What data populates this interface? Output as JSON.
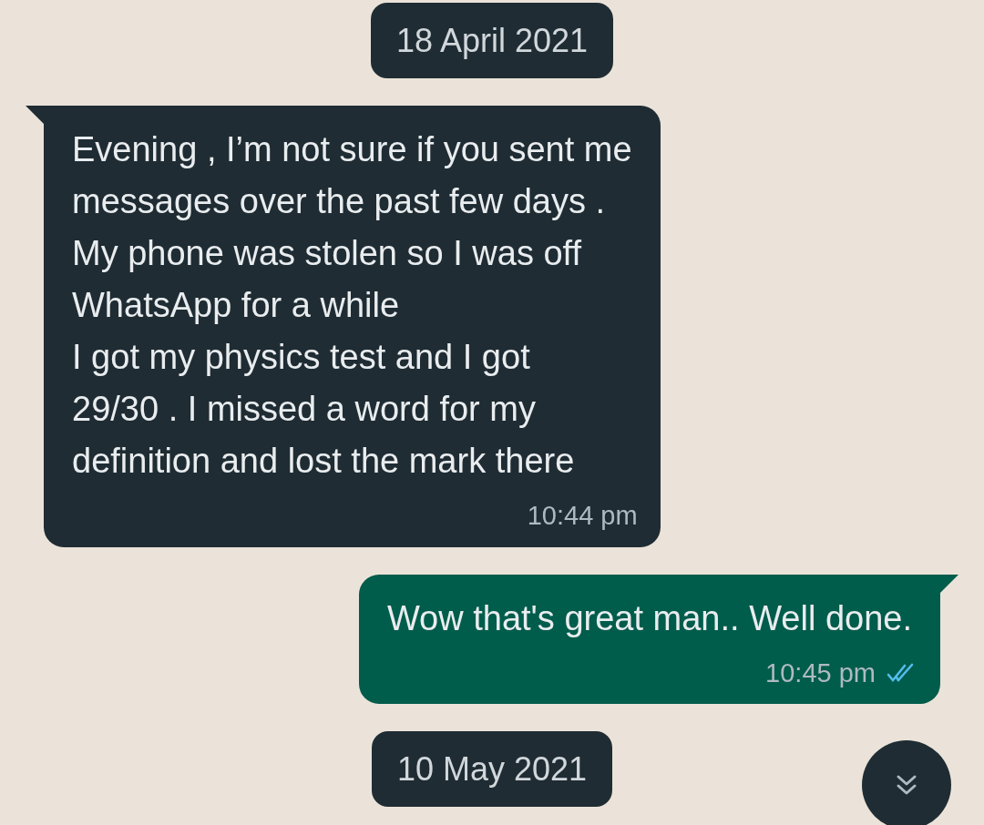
{
  "chat": [
    {
      "kind": "date",
      "label": "18 April 2021"
    },
    {
      "kind": "incoming",
      "lines": [
        "Evening , I’m not sure if you sent me",
        "messages over the past few days .",
        "My phone was stolen so I was off",
        "WhatsApp for a while",
        "I got my physics test and I got",
        "29/30 . I missed a word for my",
        "definition and lost the mark there"
      ],
      "time": "10:44 pm"
    },
    {
      "kind": "outgoing",
      "lines": [
        "Wow that's great man.. Well done."
      ],
      "time": "10:45 pm",
      "read": true
    },
    {
      "kind": "date",
      "label": "10 May 2021"
    }
  ],
  "scroll_button": {
    "visible": true
  }
}
